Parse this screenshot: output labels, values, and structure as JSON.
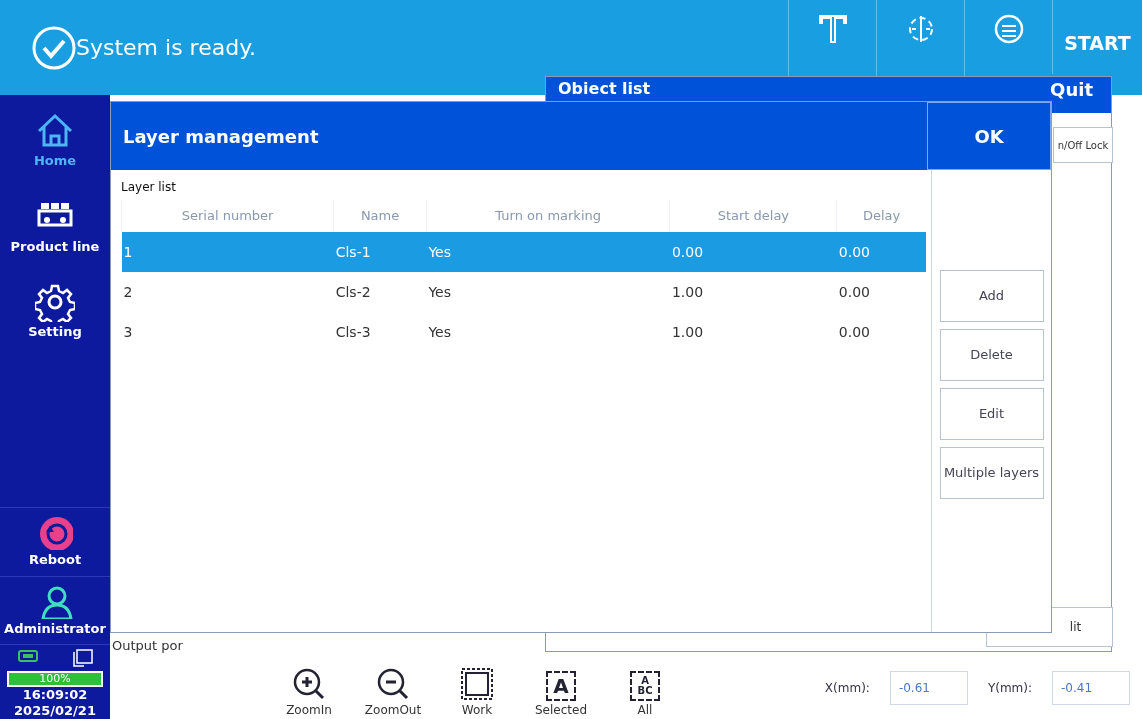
{
  "status_bar": {
    "message": "System is ready.",
    "start": "START"
  },
  "sidebar": {
    "items": [
      {
        "kind": "home",
        "label": "Home",
        "selected": true
      },
      {
        "kind": "product",
        "label": "Product line",
        "selected": false
      },
      {
        "kind": "setting",
        "label": "Setting",
        "selected": false
      }
    ],
    "bottom_items": [
      {
        "kind": "reboot",
        "label": "Reboot"
      },
      {
        "kind": "user",
        "label": "Administrator"
      }
    ],
    "battery": {
      "level": 1.0,
      "reading": "100%"
    },
    "time": "16:09:02",
    "date": "2025/02/21"
  },
  "background": {
    "lock_button": "n/Off Lock",
    "edit_button": "lit",
    "output_label": "Output por"
  },
  "bottom_toolbar": {
    "tools": [
      {
        "kind": "zoom-in",
        "label": "ZoomIn"
      },
      {
        "kind": "zoom-out",
        "label": "ZoomOut"
      },
      {
        "kind": "work",
        "label": "Work"
      },
      {
        "kind": "selected",
        "label": "Selected",
        "glyph": "A"
      },
      {
        "kind": "all",
        "label": "All",
        "glyph": "A",
        "glyph_2": "BC"
      }
    ],
    "coords": [
      {
        "label": "X(mm):",
        "value": "-0.61"
      },
      {
        "label": "Y(mm):",
        "value": "-0.41"
      }
    ]
  },
  "object_list_dialog": {
    "title": "Obiect list",
    "quit": "Quit"
  },
  "layer_dialog": {
    "title": "Layer management",
    "ok": "OK",
    "section": "Layer list",
    "table": {
      "columns": [
        "Serial number",
        "Name",
        "Turn on marking",
        "Start delay",
        "Delay"
      ],
      "rows": [
        {
          "cells": [
            "1",
            "Cls-1",
            "Yes",
            "0.00",
            "0.00"
          ],
          "selected": true
        },
        {
          "cells": [
            "2",
            "Cls-2",
            "Yes",
            "1.00",
            "0.00"
          ],
          "selected": false
        },
        {
          "cells": [
            "3",
            "Cls-3",
            "Yes",
            "1.00",
            "0.00"
          ],
          "selected": false
        }
      ]
    },
    "buttons": [
      "Add",
      "Delete",
      "Edit",
      "Multiple layers"
    ]
  }
}
